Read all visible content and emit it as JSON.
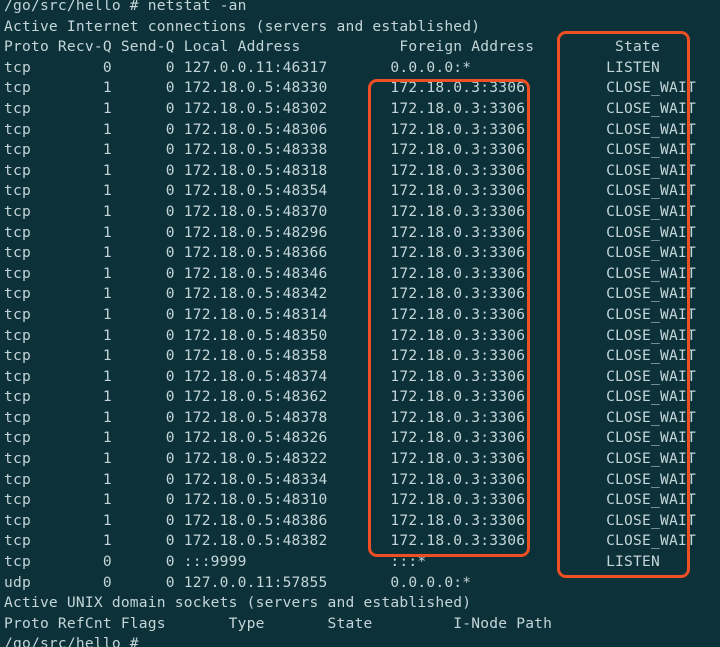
{
  "terminal": {
    "background_color": "#0c3139",
    "text_color": "#c4d5d8",
    "highlight_color": "#f04e23",
    "prompt": "/go/src/hello # ",
    "command": "netstat -an",
    "prompt_line": "/go/src/hello # netstat -an",
    "internet_section_title": "Active Internet connections (servers and established)",
    "internet_headers": {
      "proto": "Proto",
      "recv_q": "Recv-Q",
      "send_q": "Send-Q",
      "local_address": "Local Address",
      "foreign_address": "Foreign Address",
      "state": "State",
      "line": "Proto Recv-Q Send-Q Local Address           Foreign Address         State"
    },
    "connections": [
      {
        "proto": "tcp",
        "recv_q": "0",
        "send_q": "0",
        "local_address": "127.0.0.11:46317",
        "foreign_address": "0.0.0.0:*",
        "state": "LISTEN"
      },
      {
        "proto": "tcp",
        "recv_q": "1",
        "send_q": "0",
        "local_address": "172.18.0.5:48330",
        "foreign_address": "172.18.0.3:3306",
        "state": "CLOSE_WAIT"
      },
      {
        "proto": "tcp",
        "recv_q": "1",
        "send_q": "0",
        "local_address": "172.18.0.5:48302",
        "foreign_address": "172.18.0.3:3306",
        "state": "CLOSE_WAIT"
      },
      {
        "proto": "tcp",
        "recv_q": "1",
        "send_q": "0",
        "local_address": "172.18.0.5:48306",
        "foreign_address": "172.18.0.3:3306",
        "state": "CLOSE_WAIT"
      },
      {
        "proto": "tcp",
        "recv_q": "1",
        "send_q": "0",
        "local_address": "172.18.0.5:48338",
        "foreign_address": "172.18.0.3:3306",
        "state": "CLOSE_WAIT"
      },
      {
        "proto": "tcp",
        "recv_q": "1",
        "send_q": "0",
        "local_address": "172.18.0.5:48318",
        "foreign_address": "172.18.0.3:3306",
        "state": "CLOSE_WAIT"
      },
      {
        "proto": "tcp",
        "recv_q": "1",
        "send_q": "0",
        "local_address": "172.18.0.5:48354",
        "foreign_address": "172.18.0.3:3306",
        "state": "CLOSE_WAIT"
      },
      {
        "proto": "tcp",
        "recv_q": "1",
        "send_q": "0",
        "local_address": "172.18.0.5:48370",
        "foreign_address": "172.18.0.3:3306",
        "state": "CLOSE_WAIT"
      },
      {
        "proto": "tcp",
        "recv_q": "1",
        "send_q": "0",
        "local_address": "172.18.0.5:48296",
        "foreign_address": "172.18.0.3:3306",
        "state": "CLOSE_WAIT"
      },
      {
        "proto": "tcp",
        "recv_q": "1",
        "send_q": "0",
        "local_address": "172.18.0.5:48366",
        "foreign_address": "172.18.0.3:3306",
        "state": "CLOSE_WAIT"
      },
      {
        "proto": "tcp",
        "recv_q": "1",
        "send_q": "0",
        "local_address": "172.18.0.5:48346",
        "foreign_address": "172.18.0.3:3306",
        "state": "CLOSE_WAIT"
      },
      {
        "proto": "tcp",
        "recv_q": "1",
        "send_q": "0",
        "local_address": "172.18.0.5:48342",
        "foreign_address": "172.18.0.3:3306",
        "state": "CLOSE_WAIT"
      },
      {
        "proto": "tcp",
        "recv_q": "1",
        "send_q": "0",
        "local_address": "172.18.0.5:48314",
        "foreign_address": "172.18.0.3:3306",
        "state": "CLOSE_WAIT"
      },
      {
        "proto": "tcp",
        "recv_q": "1",
        "send_q": "0",
        "local_address": "172.18.0.5:48350",
        "foreign_address": "172.18.0.3:3306",
        "state": "CLOSE_WAIT"
      },
      {
        "proto": "tcp",
        "recv_q": "1",
        "send_q": "0",
        "local_address": "172.18.0.5:48358",
        "foreign_address": "172.18.0.3:3306",
        "state": "CLOSE_WAIT"
      },
      {
        "proto": "tcp",
        "recv_q": "1",
        "send_q": "0",
        "local_address": "172.18.0.5:48374",
        "foreign_address": "172.18.0.3:3306",
        "state": "CLOSE_WAIT"
      },
      {
        "proto": "tcp",
        "recv_q": "1",
        "send_q": "0",
        "local_address": "172.18.0.5:48362",
        "foreign_address": "172.18.0.3:3306",
        "state": "CLOSE_WAIT"
      },
      {
        "proto": "tcp",
        "recv_q": "1",
        "send_q": "0",
        "local_address": "172.18.0.5:48378",
        "foreign_address": "172.18.0.3:3306",
        "state": "CLOSE_WAIT"
      },
      {
        "proto": "tcp",
        "recv_q": "1",
        "send_q": "0",
        "local_address": "172.18.0.5:48326",
        "foreign_address": "172.18.0.3:3306",
        "state": "CLOSE_WAIT"
      },
      {
        "proto": "tcp",
        "recv_q": "1",
        "send_q": "0",
        "local_address": "172.18.0.5:48322",
        "foreign_address": "172.18.0.3:3306",
        "state": "CLOSE_WAIT"
      },
      {
        "proto": "tcp",
        "recv_q": "1",
        "send_q": "0",
        "local_address": "172.18.0.5:48334",
        "foreign_address": "172.18.0.3:3306",
        "state": "CLOSE_WAIT"
      },
      {
        "proto": "tcp",
        "recv_q": "1",
        "send_q": "0",
        "local_address": "172.18.0.5:48310",
        "foreign_address": "172.18.0.3:3306",
        "state": "CLOSE_WAIT"
      },
      {
        "proto": "tcp",
        "recv_q": "1",
        "send_q": "0",
        "local_address": "172.18.0.5:48386",
        "foreign_address": "172.18.0.3:3306",
        "state": "CLOSE_WAIT"
      },
      {
        "proto": "tcp",
        "recv_q": "1",
        "send_q": "0",
        "local_address": "172.18.0.5:48382",
        "foreign_address": "172.18.0.3:3306",
        "state": "CLOSE_WAIT"
      },
      {
        "proto": "tcp",
        "recv_q": "0",
        "send_q": "0",
        "local_address": ":::9999",
        "foreign_address": ":::*",
        "state": "LISTEN"
      },
      {
        "proto": "udp",
        "recv_q": "0",
        "send_q": "0",
        "local_address": "127.0.0.11:57855",
        "foreign_address": "0.0.0.0:*",
        "state": ""
      }
    ],
    "unix_section_title": "Active UNIX domain sockets (servers and established)",
    "unix_headers": {
      "proto": "Proto",
      "ref_cnt": "RefCnt",
      "flags": "Flags",
      "type": "Type",
      "state": "State",
      "inode": "I-Node",
      "path": "Path",
      "line": "Proto RefCnt Flags       Type       State         I-Node Path"
    },
    "final_prompt": "/go/src/hello # ",
    "annotations": [
      {
        "name": "foreign-address-highlight",
        "label": "Foreign Address column highlight",
        "color": "#f04e23"
      },
      {
        "name": "state-highlight",
        "label": "State column highlight",
        "color": "#f04e23"
      }
    ]
  }
}
